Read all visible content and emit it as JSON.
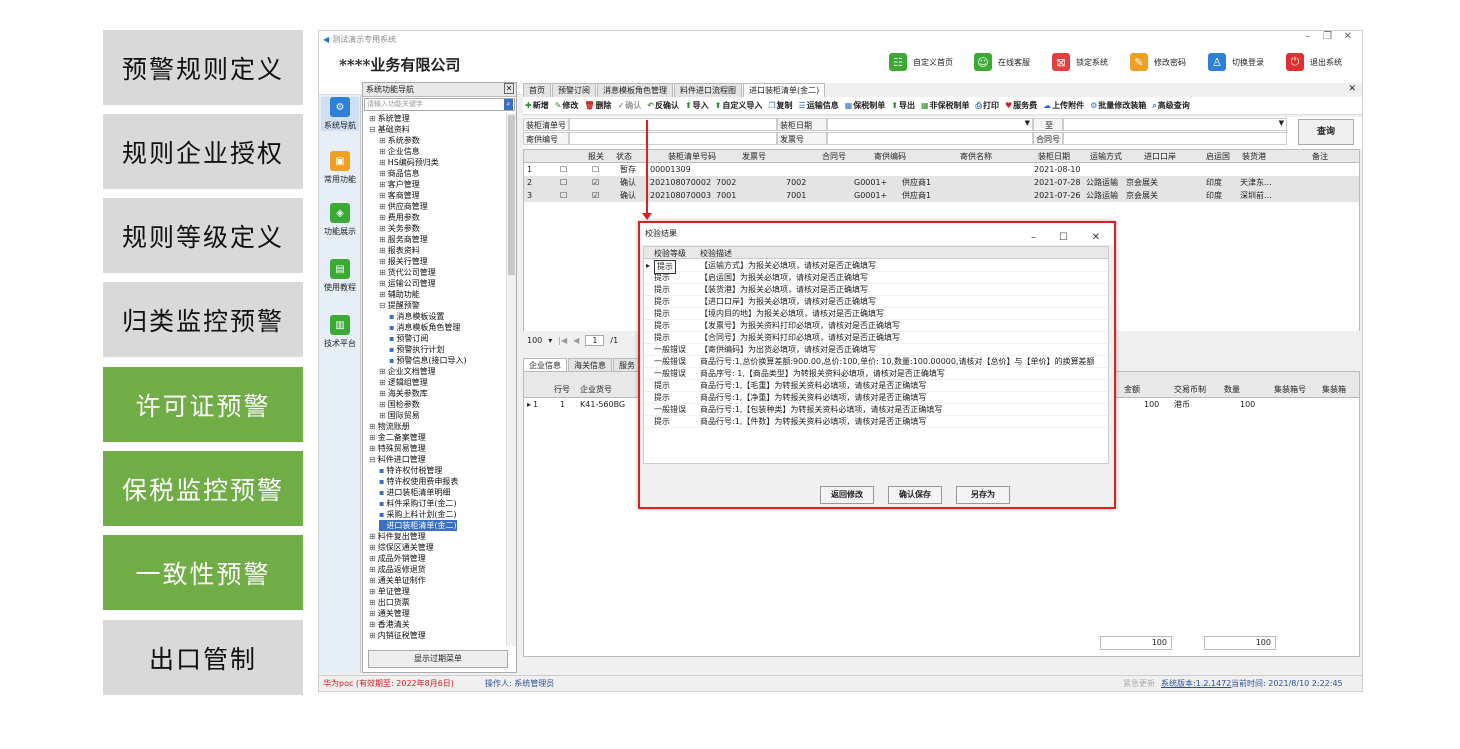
{
  "left_nav": [
    "预警规则定义",
    "规则企业授权",
    "规则等级定义",
    "归类监控预警",
    "许可证预警",
    "保税监控预警",
    "一致性预警",
    "出口管制"
  ],
  "window": {
    "title": "测试演示专用系统",
    "company": "****业务有限公司"
  },
  "header_buttons": [
    "自定义首页",
    "在线客服",
    "锁定系统",
    "修改密码",
    "切换登录",
    "退出系统"
  ],
  "vbar": [
    "系统导航",
    "常用功能",
    "功能展示",
    "使用教程",
    "技术平台"
  ],
  "tree": {
    "title": "系统功能导航",
    "search_placeholder": "请输入功能关键字",
    "show_expired": "显示过期菜单",
    "nodes": [
      "系统管理",
      "基础资料",
      "系统参数",
      "企业信息",
      "HS编码预归类",
      "商品信息",
      "客户管理",
      "客商管理",
      "供应商管理",
      "费用参数",
      "关务参数",
      "服务商管理",
      "报表资料",
      "报关行管理",
      "货代公司管理",
      "运输公司管理",
      "辅助功能",
      "提醒预警",
      "消息模板设置",
      "消息模板角色管理",
      "预警订阅",
      "预警执行计划",
      "预警信息(接口导入)",
      "企业文档管理",
      "逻辑组管理",
      "海关参数库",
      "国检参数",
      "国际贸易",
      "物流账册",
      "金二备案管理",
      "特殊贸易管理",
      "料件进口管理",
      "特许权付税管理",
      "特许权使用费申报表",
      "进口装柜清单明细",
      "料件采购订单(金二)",
      "采购上料计划(金二)",
      "进口装柜清单(金二)",
      "料件复出管理",
      "综保区通关管理",
      "成品外销管理",
      "成品返修退货",
      "通关单证制作",
      "单证管理",
      "出口货票",
      "通关管理",
      "香港清关",
      "内销征税管理"
    ]
  },
  "tabs": [
    "首页",
    "预警订阅",
    "消息模板角色管理",
    "料件进口流程图",
    "进口装柜清单(金二)"
  ],
  "toolbar": [
    "新增",
    "修改",
    "删除",
    "确认",
    "反确认",
    "导入",
    "自定义导入",
    "复制",
    "运输信息",
    "保税制单",
    "导出",
    "非保税制单",
    "打印",
    "服务费",
    "上传附件",
    "批量修改装箱",
    "高级查询"
  ],
  "form": {
    "labels": [
      "装柜清单号",
      "装柜日期",
      "至",
      "寄供编号",
      "发票号",
      "合同号"
    ],
    "query": "查询"
  },
  "grid": {
    "headers": [
      "报关",
      "状态",
      "装柜清单号码",
      "发票号",
      "合同号",
      "寄供编码",
      "寄供名称",
      "装柜日期",
      "运输方式",
      "进口口岸",
      "启运国",
      "装货港",
      "备注"
    ],
    "rows": [
      {
        "n": "1",
        "status": "暂存",
        "no": "00001309",
        "inv": "",
        "con": "",
        "code": "",
        "name": "",
        "date": "2021-08-10",
        "trans": "",
        "port": "",
        "country": "",
        "load": ""
      },
      {
        "n": "2",
        "status": "确认",
        "no": "202108070002",
        "inv": "7002",
        "con": "7002",
        "code": "G0001+",
        "name": "供应商1",
        "date": "2021-07-28",
        "trans": "公路运输",
        "port": "京会展关",
        "country": "印度",
        "load": "天津东..."
      },
      {
        "n": "3",
        "status": "确认",
        "no": "202108070003",
        "inv": "7001",
        "con": "7001",
        "code": "G0001+",
        "name": "供应商1",
        "date": "2021-07-26",
        "trans": "公路运输",
        "port": "京会展关",
        "country": "印度",
        "load": "深圳前..."
      }
    ]
  },
  "pager": {
    "size": "100",
    "page": "1",
    "of": "/1"
  },
  "lower_tabs": [
    "企业信息",
    "海关信息",
    "服务"
  ],
  "lower": {
    "headers": [
      "行号",
      "企业货号",
      "金额",
      "交易币制",
      "数量",
      "集装箱号",
      "集装箱"
    ],
    "row": {
      "n": "1",
      "line": "1",
      "part": "K41-560BG",
      "amount": "100",
      "currency": "港币",
      "qty": "100"
    },
    "sum1": "100",
    "sum2": "100"
  },
  "status": {
    "left": "华为poc (有效期至: 2022年8月6日)",
    "operator": "操作人: 系统管理员",
    "update": "紧急更新",
    "version": "系统版本:1.2.1472",
    "time": "当前时间: 2021/8/10 2:22:45"
  },
  "dialog": {
    "title": "校验结果",
    "col1": "校验等级",
    "col2": "校验描述",
    "rows": [
      [
        "提示",
        "【运输方式】为报关必填项，请核对是否正确填写"
      ],
      [
        "提示",
        "【启运国】为报关必填项，请核对是否正确填写"
      ],
      [
        "提示",
        "【装货港】为报关必填项，请核对是否正确填写"
      ],
      [
        "提示",
        "【进口口岸】为报关必填项，请核对是否正确填写"
      ],
      [
        "提示",
        "【境内目的地】为报关必填项，请核对是否正确填写"
      ],
      [
        "提示",
        "【发票号】为报关资料打印必填项，请核对是否正确填写"
      ],
      [
        "提示",
        "【合同号】为报关资料打印必填项，请核对是否正确填写"
      ],
      [
        "一般错误",
        "【寄供编码】为出货必填项，请核对是否正确填写"
      ],
      [
        "一般错误",
        "商品行号:1,总价换算差额:900.00,总价:100,单价: 10,数量:100.00000,请核对【总价】与【单价】的换算差额"
      ],
      [
        "一般错误",
        "商品序号: 1,【商品类型】为转报关资料必填项，请核对是否正确填写"
      ],
      [
        "提示",
        "商品行号:1,【毛重】为转报关资料必填项，请核对是否正确填写"
      ],
      [
        "提示",
        "商品行号:1,【净重】为转报关资料必填项，请核对是否正确填写"
      ],
      [
        "一般错误",
        "商品行号:1,【包装种类】为转报关资料必填项，请核对是否正确填写"
      ],
      [
        "提示",
        "商品行号:1,【件数】为转报关资料必填项，请核对是否正确填写"
      ]
    ],
    "buttons": [
      "返回修改",
      "确认保存",
      "另存为"
    ]
  }
}
